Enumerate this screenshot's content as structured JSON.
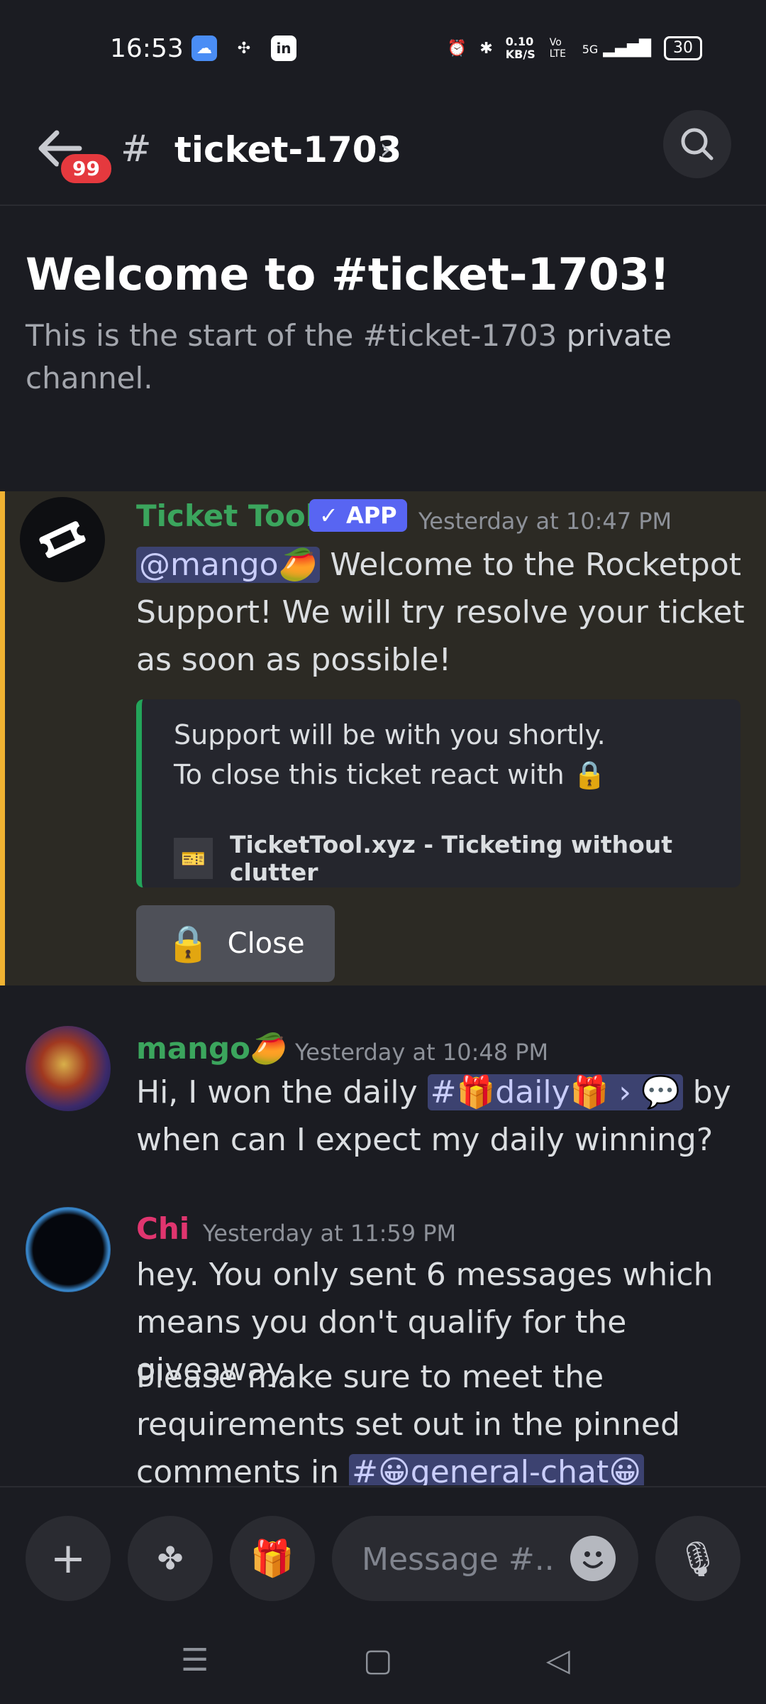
{
  "status_bar": {
    "time": "16:53",
    "net_speed": "0.10 KB/S",
    "volte": "Vo LTE",
    "signal": "5G",
    "battery": "30"
  },
  "header": {
    "badge": "99",
    "channel": "ticket-1703"
  },
  "welcome": {
    "title": "Welcome to #ticket-1703!",
    "subtitle_prefix": "This is the start of the #ticket-1703",
    "subtitle_strong": "private",
    "subtitle_suffix": "channel."
  },
  "messages": [
    {
      "author": "Ticket Tool",
      "author_color": "#3ba55d",
      "tag": "APP",
      "timestamp": "Yesterday at 10:47 PM",
      "mention": "@mango🥭",
      "text": " Welcome to the Rocketpot Support! We will try resolve your ticket as soon as possible!",
      "embed": {
        "line1": "Support will be with you shortly.",
        "line2": "To close this ticket react with 🔒",
        "footer": "TicketTool.xyz - Ticketing without clutter"
      },
      "button": "Close"
    },
    {
      "author": "mango🥭",
      "author_color": "#3ba55d",
      "timestamp": "Yesterday at 10:48 PM",
      "text_before": "Hi,  I won the daily ",
      "channel_link": "#🎁daily🎁 › 💬",
      "text_after": " by when can I expect my daily winning?"
    },
    {
      "author": "Chi",
      "author_color": "#e0356f",
      "timestamp": "Yesterday at 11:59 PM",
      "text1": "hey.  You only sent 6 messages which means you don't qualify for the giveaway.",
      "text2_before": "Please make sure to meet the requirements set out in the pinned comments in ",
      "channel_link": "#😀general-chat😀"
    }
  ],
  "composer": {
    "placeholder": "Message #..."
  }
}
